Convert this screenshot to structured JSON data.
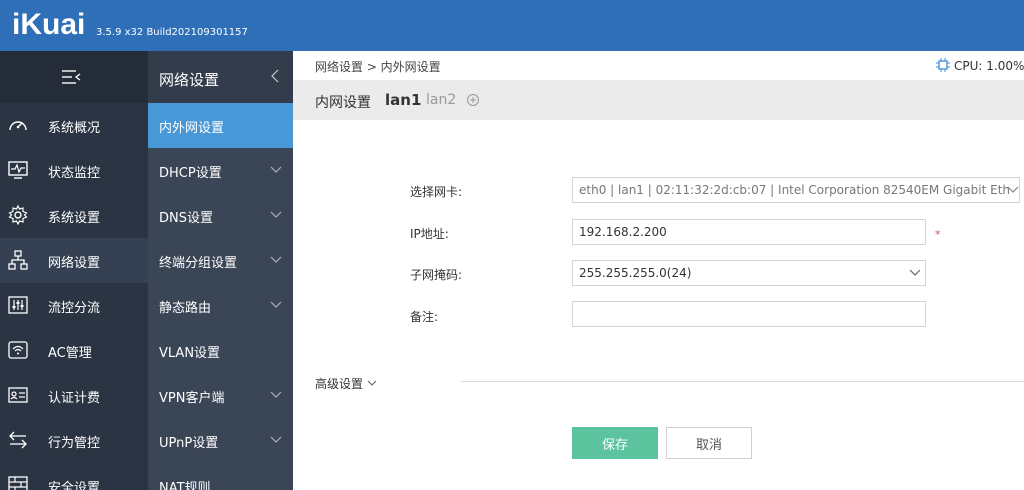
{
  "header": {
    "logo": "iKuai",
    "version": "3.5.9 x32 Build202109301157"
  },
  "sidebar": {
    "items": [
      {
        "label": "系统概况",
        "icon": "speedometer-icon"
      },
      {
        "label": "状态监控",
        "icon": "monitor-pulse-icon"
      },
      {
        "label": "系统设置",
        "icon": "gear-icon"
      },
      {
        "label": "网络设置",
        "icon": "network-tree-icon"
      },
      {
        "label": "流控分流",
        "icon": "sliders-icon"
      },
      {
        "label": "AC管理",
        "icon": "wifi-box-icon"
      },
      {
        "label": "认证计费",
        "icon": "id-card-icon"
      },
      {
        "label": "行为管控",
        "icon": "swap-arrows-icon"
      },
      {
        "label": "安全设置",
        "icon": "firewall-icon"
      }
    ]
  },
  "submenu": {
    "title": "网络设置",
    "items": [
      {
        "label": "内外网设置"
      },
      {
        "label": "DHCP设置"
      },
      {
        "label": "DNS设置"
      },
      {
        "label": "终端分组设置"
      },
      {
        "label": "静态路由"
      },
      {
        "label": "VLAN设置"
      },
      {
        "label": "VPN客户端"
      },
      {
        "label": "UPnP设置"
      },
      {
        "label": "NAT规则"
      }
    ]
  },
  "breadcrumb": "网络设置 > 内外网设置",
  "cpu": "CPU: 1.00%",
  "tabs": {
    "heading": "内网设置",
    "active": "lan1",
    "inactive": "lan2"
  },
  "form": {
    "nic_label": "选择网卡:",
    "nic_value": "eth0 | lan1 | 02:11:32:2d:cb:07 | Intel Corporation 82540EM Gigabit Eth",
    "ip_label": "IP地址:",
    "ip_value": "192.168.2.200",
    "required_mark": "*",
    "mask_label": "子网掩码:",
    "mask_value": "255.255.255.0(24)",
    "note_label": "备注:",
    "note_value": ""
  },
  "advanced_label": "高级设置",
  "buttons": {
    "save": "保存",
    "cancel": "取消"
  },
  "colors": {
    "header": "#2f6fb7",
    "sidebar": "#2a3442",
    "submenu": "#3a4556",
    "active_submenu": "#4898d8",
    "save_button": "#5cc39f",
    "required": "#e04848"
  }
}
